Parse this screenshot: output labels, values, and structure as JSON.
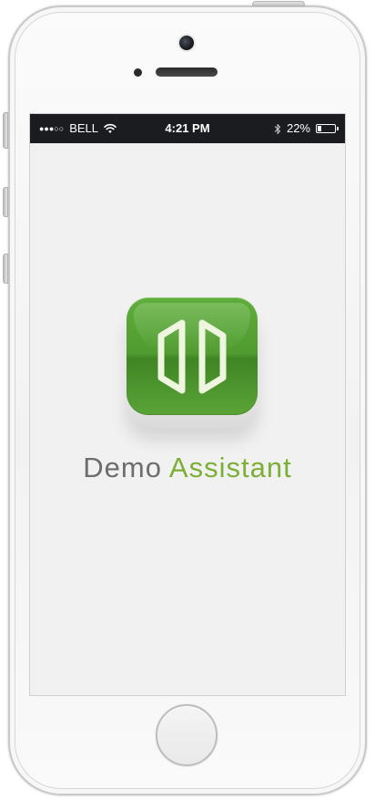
{
  "device": {
    "buttons": [
      "mute-switch",
      "volume-up",
      "volume-down",
      "power-button",
      "home-button"
    ]
  },
  "status_bar": {
    "signal": "●●●○○",
    "carrier": "BELL",
    "time": "4:21 PM",
    "battery_percent_text": "22%",
    "battery_level": 0.22,
    "icons": [
      "wifi-icon",
      "bluetooth-icon",
      "battery-icon"
    ]
  },
  "app": {
    "icon": "hexagon-logo-icon",
    "name_part1": "Demo",
    "name_part2": "Assistant"
  },
  "colors": {
    "status_bar_bg": "#1b1c1f",
    "screen_bg": "#f1f1f1",
    "icon_green": "#4f9b2f",
    "accent_green": "#7caf37",
    "text_gray": "#6d6d6d"
  }
}
